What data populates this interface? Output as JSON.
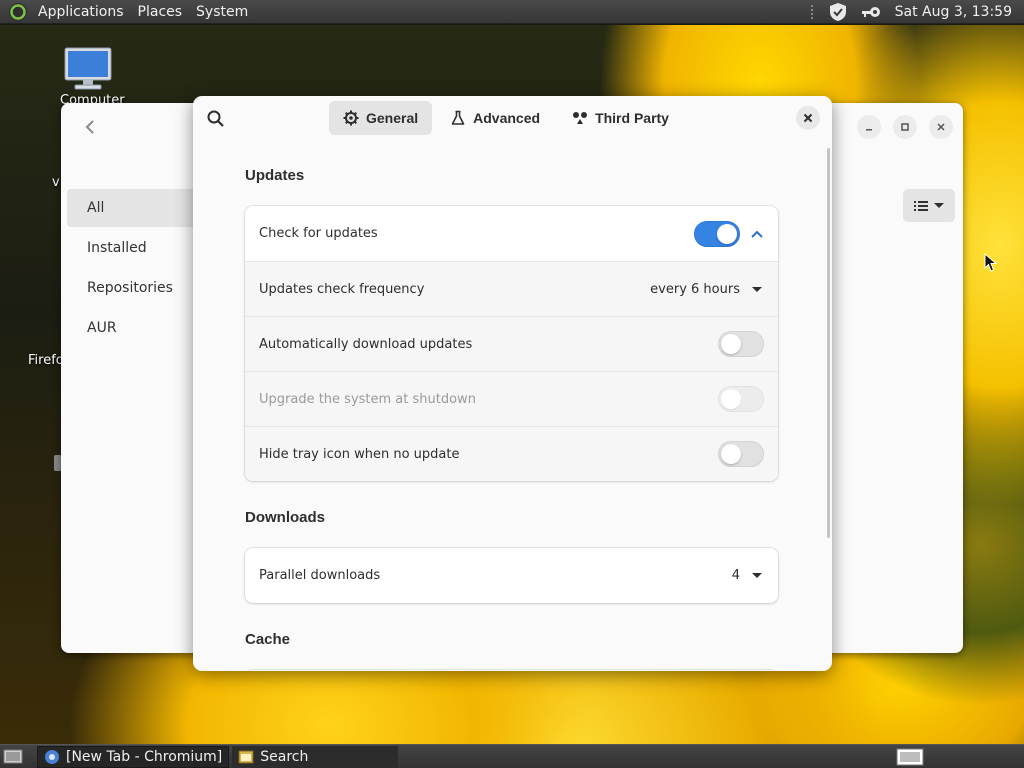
{
  "top_panel": {
    "menus": [
      "Applications",
      "Places",
      "System"
    ],
    "clock": "Sat Aug  3, 13:59"
  },
  "desktop": {
    "icons": [
      {
        "label": "Computer",
        "icon": "computer-icon"
      },
      {
        "label": "vi",
        "icon": "file-icon"
      },
      {
        "label": "Firefo",
        "icon": "firefox-icon"
      }
    ]
  },
  "app_window": {
    "sidebar": [
      "All",
      "Installed",
      "Repositories",
      "AUR"
    ],
    "active_sidebar": "All"
  },
  "dialog": {
    "tabs": [
      {
        "label": "General",
        "icon": "gear-icon",
        "active": true
      },
      {
        "label": "Advanced",
        "icon": "flask-icon",
        "active": false
      },
      {
        "label": "Third Party",
        "icon": "third-party-icon",
        "active": false
      }
    ],
    "updates": {
      "title": "Updates",
      "check_for_updates": {
        "label": "Check for updates",
        "enabled": true
      },
      "check_frequency": {
        "label": "Updates check frequency",
        "value": "every 6 hours"
      },
      "auto_download": {
        "label": "Automatically download updates",
        "enabled": false
      },
      "upgrade_shutdown": {
        "label": "Upgrade the system at shutdown",
        "enabled": false,
        "disabled": true
      },
      "hide_tray": {
        "label": "Hide tray icon when no update",
        "enabled": false
      }
    },
    "downloads": {
      "title": "Downloads",
      "parallel": {
        "label": "Parallel downloads",
        "value": "4"
      }
    },
    "cache": {
      "title": "Cache"
    }
  },
  "taskbar": {
    "tasks": [
      {
        "label": "[New Tab - Chromium]",
        "icon": "chromium-icon"
      },
      {
        "label": "Search",
        "icon": "search-window-icon"
      }
    ]
  },
  "colors": {
    "accent": "#3584e4",
    "panel": "#3c3c3c",
    "dialog_bg": "#fafafa"
  }
}
